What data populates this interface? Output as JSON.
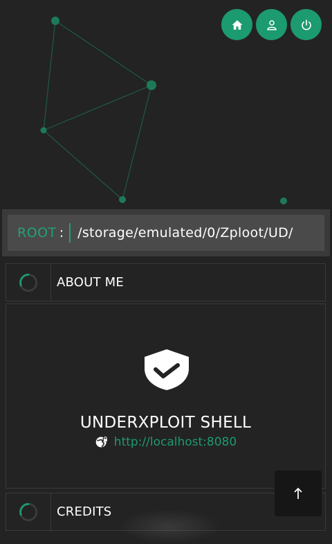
{
  "header": {
    "buttons": [
      {
        "name": "home-button",
        "icon": "home-icon"
      },
      {
        "name": "user-button",
        "icon": "user-icon"
      },
      {
        "name": "power-button",
        "icon": "power-icon"
      }
    ],
    "accent_color": "#1c9a70"
  },
  "path_bar": {
    "label": "ROOT",
    "separator": ":",
    "value": "/storage/emulated/0/Zploot/UD/"
  },
  "sections": {
    "about": {
      "title": "ABOUT ME"
    },
    "credits": {
      "title": "CREDITS"
    }
  },
  "card": {
    "icon": "shield-check-icon",
    "title": "UNDERXPLOIT SHELL",
    "link_icon": "globe-lock-icon",
    "link": "http://localhost:8080"
  },
  "scroll_top": {
    "icon": "arrow-up-icon",
    "label": "↑"
  }
}
